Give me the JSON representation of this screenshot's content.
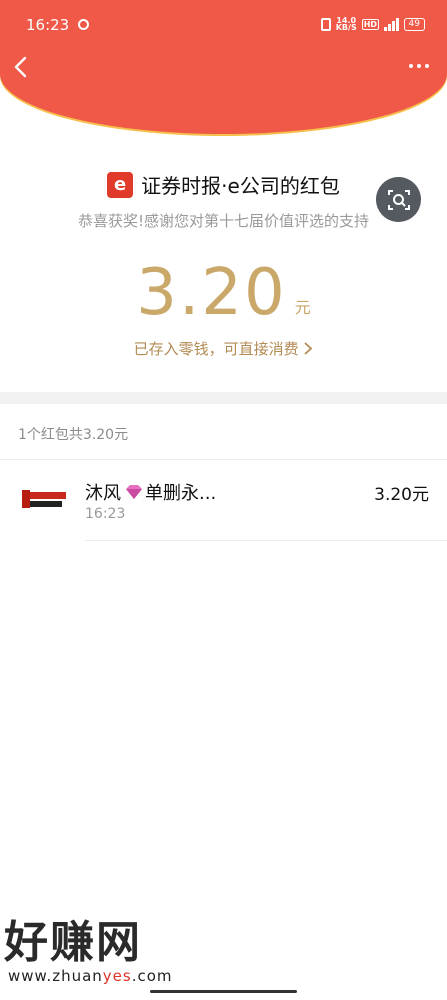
{
  "status_bar": {
    "time": "16:23",
    "net_speed_value": "14.0",
    "net_speed_unit": "KB/S",
    "hd_label": "HD",
    "battery": "49"
  },
  "header": {
    "back_icon": "chevron-left-icon",
    "more_icon": "more-dots-icon",
    "color": "#f05848"
  },
  "sender": {
    "logo_text": "e",
    "name": "证券时报·e公司的红包",
    "greeting": "恭喜获奖!感谢您对第十七届价值评选的支持"
  },
  "amount": {
    "value": "3.20",
    "unit": "元",
    "saved_text": "已存入零钱，可直接消费",
    "accent_color": "#c9a86a"
  },
  "summary": {
    "text": "1个红包共3.20元"
  },
  "records": [
    {
      "name_part1": "沐风",
      "name_part2": "单删永...",
      "time": "16:23",
      "amount": "3.20元"
    }
  ],
  "watermark": {
    "title": "好赚网",
    "url_part1": "www.zhuan",
    "url_part2": "yes",
    "url_part3": ".com"
  }
}
